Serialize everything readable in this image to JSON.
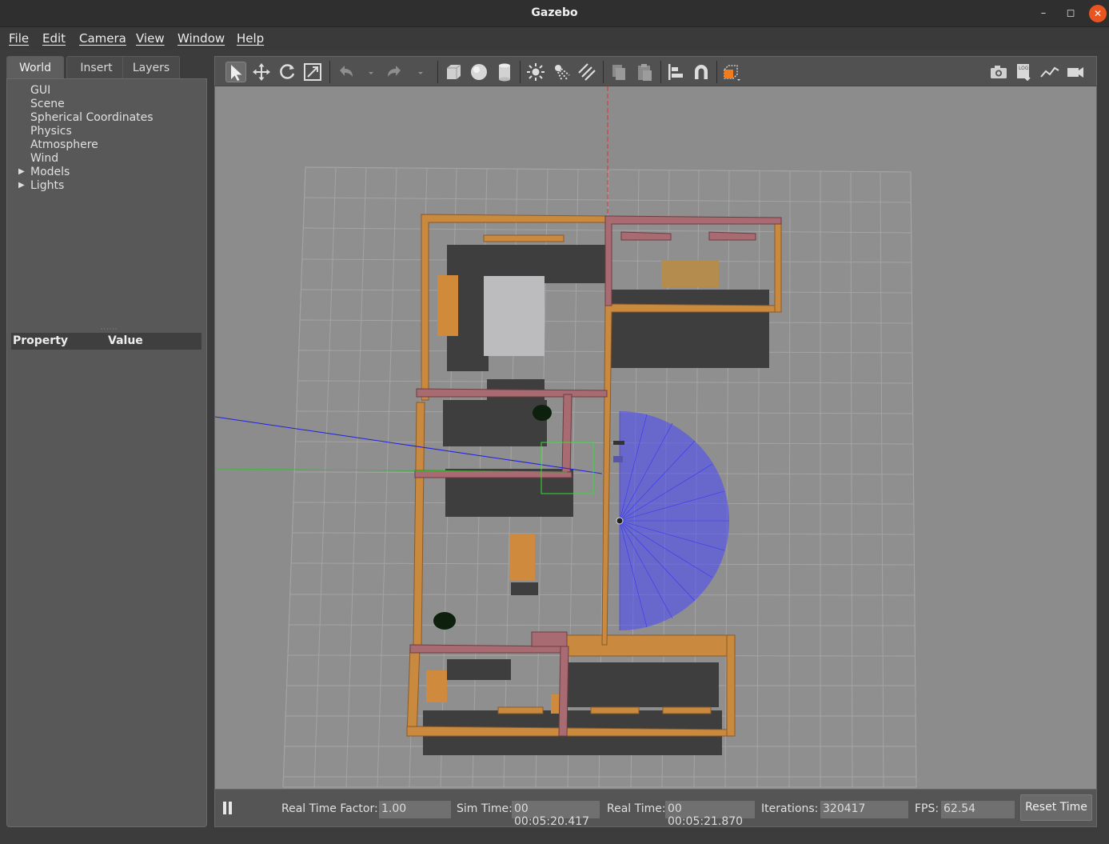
{
  "window": {
    "title": "Gazebo"
  },
  "menubar": [
    "File",
    "Edit",
    "Camera",
    "View",
    "Window",
    "Help"
  ],
  "left_panel": {
    "tabs": [
      "World",
      "Insert",
      "Layers"
    ],
    "active_tab": "World",
    "tree": [
      "GUI",
      "Scene",
      "Spherical Coordinates",
      "Physics",
      "Atmosphere",
      "Wind",
      "Models",
      "Lights"
    ],
    "property_header": {
      "property": "Property",
      "value": "Value"
    }
  },
  "toolbar": {
    "tools": [
      "select-icon",
      "translate-icon",
      "rotate-icon",
      "scale-icon",
      "undo-icon",
      "redo-icon",
      "box-icon",
      "sphere-icon",
      "cylinder-icon",
      "point-light-icon",
      "spot-light-icon",
      "directional-light-icon",
      "copy-icon",
      "paste-icon",
      "align-icon",
      "snap-icon",
      "view-angle-icon",
      "screenshot-icon",
      "log-icon",
      "plot-icon",
      "record-icon"
    ]
  },
  "bottom_bar": {
    "real_time_factor_label": "Real Time Factor:",
    "real_time_factor": "1.00",
    "sim_time_label": "Sim Time:",
    "sim_time": "00 00:05:20.417",
    "real_time_label": "Real Time:",
    "real_time": "00 00:05:21.870",
    "iterations_label": "Iterations:",
    "iterations": "320417",
    "fps_label": "FPS:",
    "fps": "62.54",
    "reset_label": "Reset Time"
  },
  "colors": {
    "viewport_bg": "#8c8c8c",
    "wall_wood": "#c98a3f",
    "wall_brick": "#a86b72",
    "laser": "#3a3aff",
    "selection": "#33dd33"
  }
}
